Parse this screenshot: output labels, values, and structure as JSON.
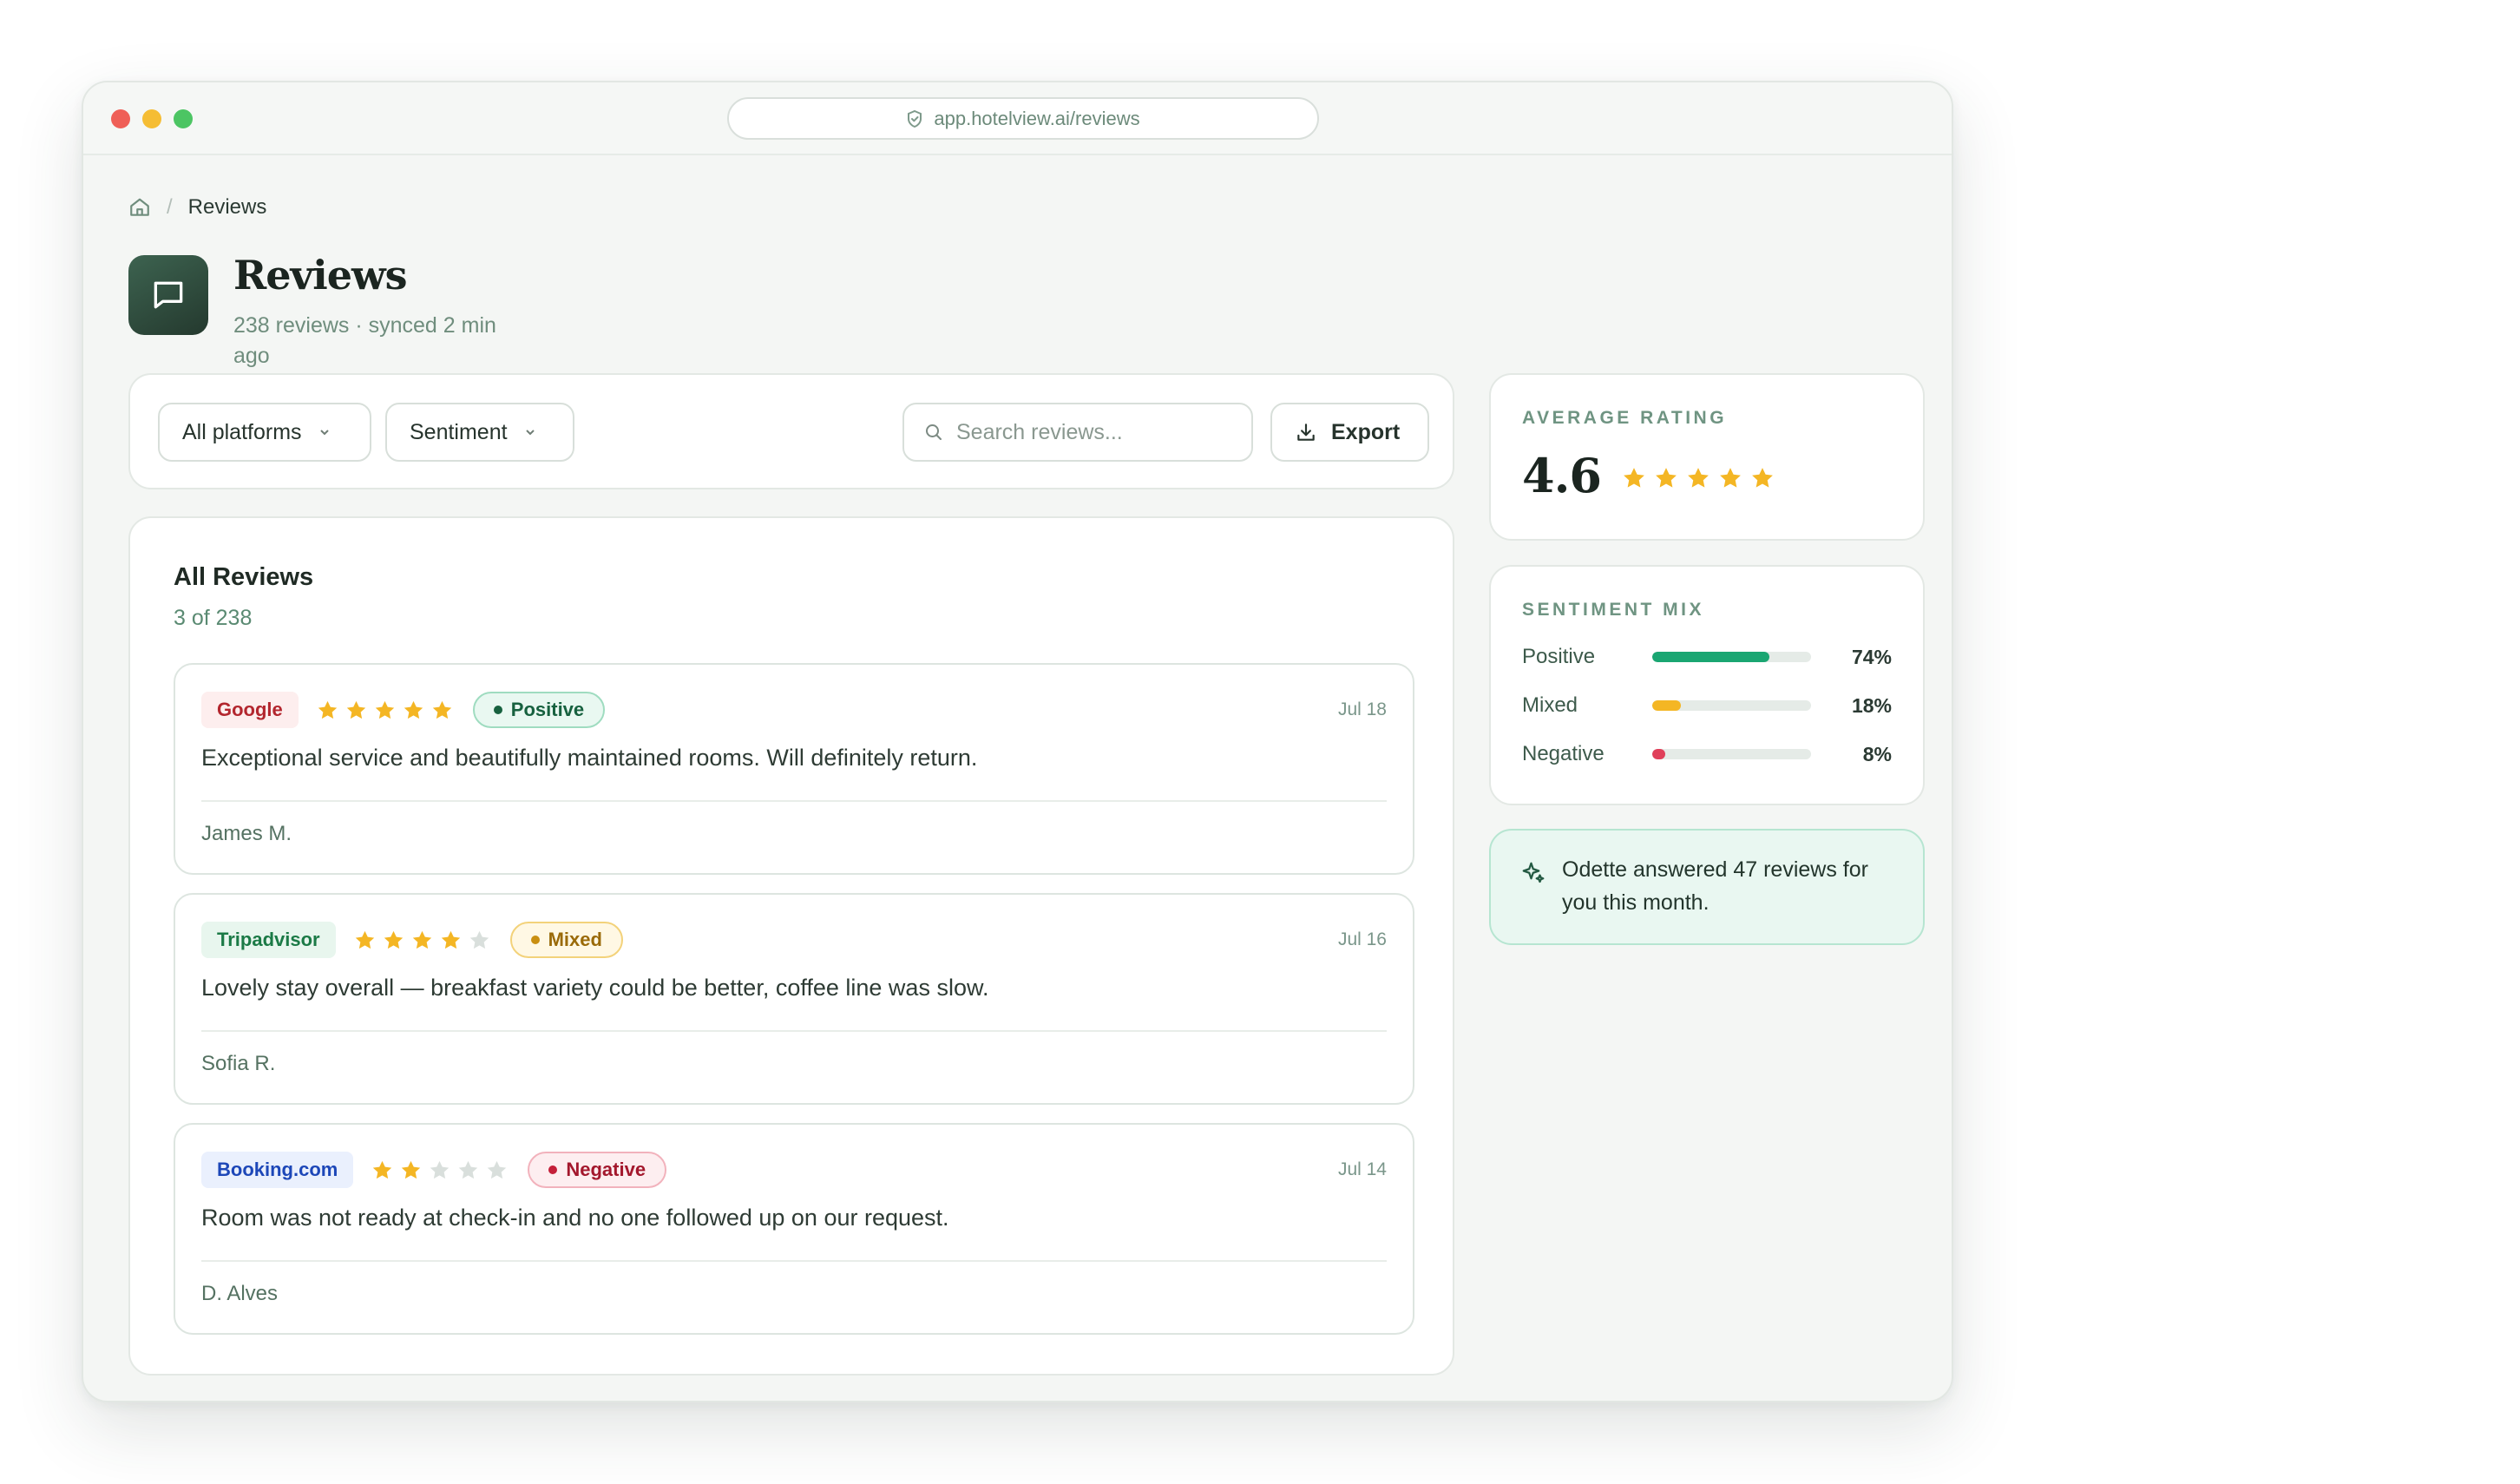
{
  "browser": {
    "url": "app.hotelview.ai/reviews",
    "icon": "shield-icon"
  },
  "breadcrumb": {
    "home_icon": "home-icon",
    "separator": "/",
    "current": "Reviews"
  },
  "page": {
    "title": "Reviews",
    "subtitle": "238 reviews · synced 2 min ago",
    "icon": "message-square-icon"
  },
  "filters": {
    "platforms_label": "All platforms",
    "sentiment_label": "Sentiment",
    "search_placeholder": "Search reviews...",
    "export_label": "Export"
  },
  "list": {
    "title": "All Reviews",
    "count": "3 of 238"
  },
  "reviews": [
    {
      "platform": "Google",
      "rating": 5,
      "sentiment": "Positive",
      "date": "Jul 18",
      "text": "Exceptional service and beautifully maintained rooms. Will definitely return.",
      "author": "James M."
    },
    {
      "platform": "Tripadvisor",
      "rating": 4,
      "sentiment": "Mixed",
      "date": "Jul 16",
      "text": "Lovely stay overall — breakfast variety could be better, coffee line was slow.",
      "author": "Sofia R."
    },
    {
      "platform": "Booking.com",
      "rating": 2,
      "sentiment": "Negative",
      "date": "Jul 14",
      "text": "Room was not ready at check-in and no one followed up on our request.",
      "author": "D. Alves"
    }
  ],
  "summary": {
    "average_label": "AVERAGE RATING",
    "average_value": "4.6",
    "average_stars": 5,
    "mix_label": "SENTIMENT MIX",
    "mix": [
      {
        "label": "Positive",
        "percent_text": "74%",
        "fraction": 0.74,
        "color": "#1aa672"
      },
      {
        "label": "Mixed",
        "percent_text": "18%",
        "fraction": 0.18,
        "color": "#f4b624"
      },
      {
        "label": "Negative",
        "percent_text": "8%",
        "fraction": 0.08,
        "color": "#e0405a"
      }
    ],
    "odette_message": "Odette answered 47 reviews for you this month.",
    "odette_icon": "sparkles-icon"
  },
  "colors": {
    "accent": "#2f4a3d",
    "star": "#f4b624",
    "star_empty": "#d9dfdc",
    "google_text": "#b3262e",
    "google_bg": "#fdeeee",
    "tripadvisor_text": "#1b7a46",
    "tripadvisor_bg": "#e8f6ee",
    "booking_text": "#1d47b8",
    "booking_bg": "#eaf0fd",
    "positive_text": "#17613f",
    "positive_bg": "#e9f8f1",
    "positive_border": "#9fdcc0",
    "mixed_text": "#9a6a08",
    "mixed_bg": "#fff8e4",
    "mixed_border": "#f3d27a",
    "negative_text": "#a3182d",
    "negative_bg": "#fdeef0",
    "negative_border": "#f2b2bc"
  }
}
